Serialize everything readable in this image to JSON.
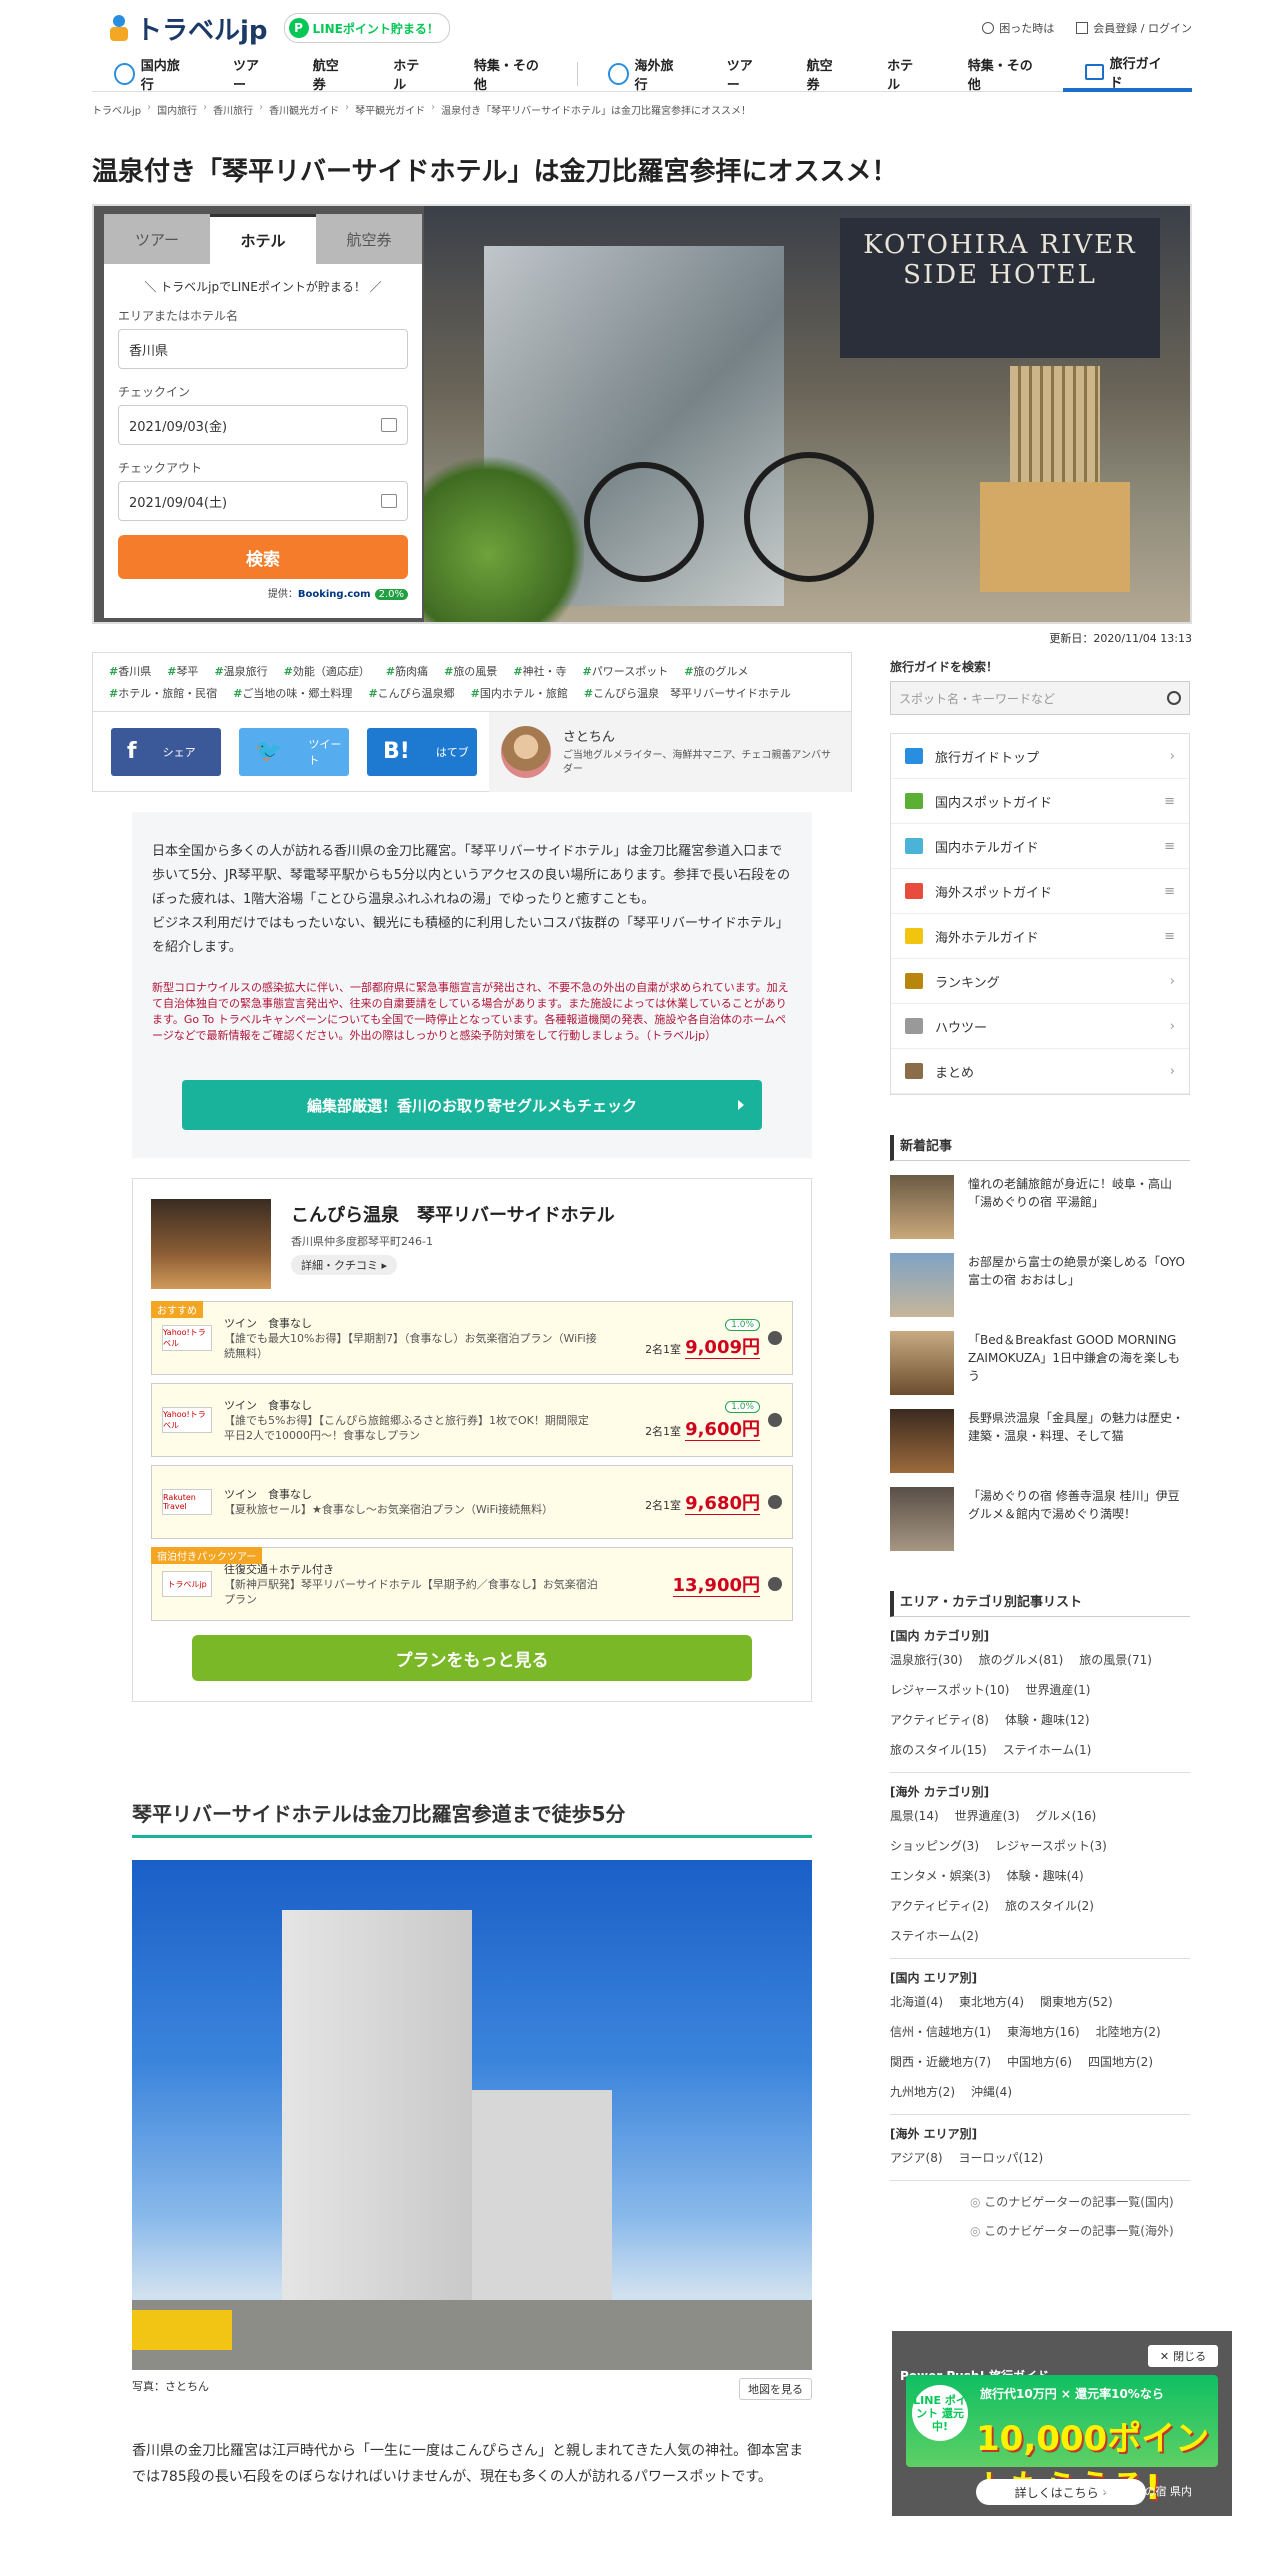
{
  "header": {
    "logo": "トラベルjp",
    "line_pill": "LINEポイント貯まる！",
    "help": "困った時は",
    "login": "会員登録 / ログイン",
    "nav": [
      "国内旅行",
      "ツアー",
      "航空券",
      "ホテル",
      "特集・その他",
      "海外旅行",
      "ツアー",
      "航空券",
      "ホテル",
      "特集・その他"
    ],
    "guide": "旅行ガイド"
  },
  "breadcrumb": [
    "トラベルjp",
    "国内旅行",
    "香川旅行",
    "香川観光ガイド",
    "琴平観光ガイド",
    "温泉付き「琴平リバーサイドホテル」は金刀比羅宮参拝にオススメ！"
  ],
  "title": "温泉付き「琴平リバーサイドホテル」は金刀比羅宮参拝にオススメ！",
  "hero": {
    "sign": "KOTOHIRA RIVER SIDE HOTEL"
  },
  "search": {
    "tabs": [
      "ツアー",
      "ホテル",
      "航空券"
    ],
    "promo": "＼ トラベルjpでLINEポイントが貯まる！ ／",
    "area_label": "エリアまたはホテル名",
    "area_value": "香川県",
    "checkin_label": "チェックイン",
    "checkin_value": "2021/09/03(金)",
    "checkout_label": "チェックアウト",
    "checkout_value": "2021/09/04(土)",
    "button": "検索",
    "provider_prefix": "提供：",
    "provider": "Booking.com",
    "provider_pct": "2.0%"
  },
  "updated": "更新日：2020/11/04 13:13",
  "tags": [
    "香川県",
    "琴平",
    "温泉旅行",
    "効能（適応症）",
    "筋肉痛",
    "旅の風景",
    "神社・寺",
    "パワースポット",
    "旅のグルメ",
    "ホテル・旅館・民宿",
    "ご当地の味・郷土料理",
    "こんぴら温泉郷",
    "国内ホテル・旅館",
    "こんぴら温泉　琴平リバーサイドホテル"
  ],
  "share": {
    "fb": "シェア",
    "tw": "ツイート",
    "hb": "はてブ",
    "fb_icon": "f",
    "hb_icon": "B!"
  },
  "author": {
    "name": "さとちん",
    "desc": "ご当地グルメライター、海鮮丼マニア、チェコ親善アンバサダー"
  },
  "lead": {
    "p1": "日本全国から多くの人が訪れる香川県の金刀比羅宮。「琴平リバーサイドホテル」は金刀比羅宮参道入口まで歩いて5分、JR琴平駅、琴電琴平駅からも5分以内というアクセスの良い場所にあります。参拝で長い石段をのぼった疲れは、1階大浴場「ことひら温泉ふれふれねの湯」でゆったりと癒すことも。",
    "p2": "ビジネス利用だけではもったいない、観光にも積極的に利用したいコスパ抜群の「琴平リバーサイドホテル」を紹介します。",
    "warn": "新型コロナウイルスの感染拡大に伴い、一部都府県に緊急事態宣言が発出され、不要不急の外出の自粛が求められています。加えて自治体独自での緊急事態宣言発出や、往来の自粛要請をしている場合があります。また施設によっては休業していることがあります。Go To トラベルキャンペーンについても全国で一時停止となっています。各種報道機関の発表、施設や各自治体のホームページなどで最新情報をご確認ください。外出の際はしっかりと感染予防対策をして行動しましょう。（トラベルjp）",
    "button": "編集部厳選！香川のお取り寄せグルメもチェック"
  },
  "hotel": {
    "name": "こんぴら温泉　琴平リバーサイドホテル",
    "address": "香川県仲多度郡琴平町246-1",
    "review": "詳細・クチコミ ▸",
    "plans": [
      {
        "badge": "おすすめ",
        "logo": "Yahoo!トラベル",
        "room": "ツイン　食事なし",
        "desc": "【誰でも最大10%お得】【早期割7】（食事なし）お気楽宿泊プラン（WiFi接続無料）",
        "points": "1.0%",
        "per": "2名1室",
        "price": "9,009円"
      },
      {
        "badge": "",
        "logo": "Yahoo!トラベル",
        "room": "ツイン　食事なし",
        "desc": "【誰でも5%お得】【こんぴら旅館郷ふるさと旅行券】1枚でOK！期間限定　平日2人で10000円～！食事なしプラン",
        "points": "1.0%",
        "per": "2名1室",
        "price": "9,600円"
      },
      {
        "badge": "",
        "logo": "Rakuten Travel",
        "room": "ツイン　食事なし",
        "desc": "【夏秋旅セール】★食事なし〜お気楽宿泊プラン（WiFi接続無料）",
        "points": "",
        "per": "2名1室",
        "price": "9,680円"
      },
      {
        "badge": "宿泊付きパックツアー",
        "logo": "トラベルjp",
        "room": "往復交通＋ホテル付き",
        "desc": "【新神戸駅発】琴平リバーサイドホテル【早期予約／食事なし】お気楽宿泊プラン",
        "points": "",
        "per": "",
        "price": "13,900円"
      }
    ],
    "more": "プランをもっと見る"
  },
  "section": {
    "title": "琴平リバーサイドホテルは金刀比羅宮参道まで徒歩5分",
    "caption": "写真：さとちん",
    "map": "地図を見る",
    "text": "香川県の金刀比羅宮は江戸時代から「一生に一度はこんぴらさん」と親しまれてきた人気の神社。御本宮までは785段の長い石段をのぼらなければいけませんが、現在も多くの人が訪れるパワースポットです。"
  },
  "sidebar": {
    "search_title": "旅行ガイドを検索！",
    "search_placeholder": "スポット名・キーワードなど",
    "menu": [
      "旅行ガイドトップ",
      "国内スポットガイド",
      "国内ホテルガイド",
      "海外スポットガイド",
      "海外ホテルガイド",
      "ランキング",
      "ハウツー",
      "まとめ"
    ],
    "news_title": "新着記事",
    "news": [
      "憧れの老舗旅館が身近に！岐阜・高山「湯めぐりの宿 平湯館」",
      "お部屋から富士の絶景が楽しめる「OYO 富士の宿 おおはし」",
      "「Bed＆Breakfast GOOD MORNING ZAIMOKUZA」1日中鎌倉の海を楽しもう",
      "長野県渋温泉「金具屋」の魅力は歴史・建築・温泉・料理、そして猫",
      "「湯めぐりの宿 修善寺温泉 桂川」伊豆グルメ＆館内で湯めぐり満喫！"
    ],
    "cat_title": "エリア・カテゴリ別記事リスト",
    "cats": [
      {
        "h": "[国内 カテゴリ別]",
        "links": [
          "温泉旅行(30)",
          "旅のグルメ(81)",
          "旅の風景(71)",
          "レジャースポット(10)",
          "世界遺産(1)",
          "アクティビティ(8)",
          "体験・趣味(12)",
          "旅のスタイル(15)",
          "ステイホーム(1)"
        ]
      },
      {
        "h": "[海外 カテゴリ別]",
        "links": [
          "風景(14)",
          "世界遺産(3)",
          "グルメ(16)",
          "ショッピング(3)",
          "レジャースポット(3)",
          "エンタメ・娯楽(3)",
          "体験・趣味(4)",
          "アクティビティ(2)",
          "旅のスタイル(2)",
          "ステイホーム(2)"
        ]
      },
      {
        "h": "[国内 エリア別]",
        "links": [
          "北海道(4)",
          "東北地方(4)",
          "関東地方(52)",
          "信州・信越地方(1)",
          "東海地方(16)",
          "北陸地方(2)",
          "関西・近畿地方(7)",
          "中国地方(6)",
          "四国地方(2)",
          "九州地方(2)",
          "沖縄(4)"
        ]
      },
      {
        "h": "[海外 エリア別]",
        "links": [
          "アジア(8)",
          "ヨーロッパ(12)"
        ]
      }
    ],
    "nav_links": [
      "このナビゲーターの記事一覧(国内)",
      "このナビゲーターの記事一覧(海外)"
    ]
  },
  "popup": {
    "close": "閉じる",
    "badge": "LINE ポイント 還元中!",
    "top": "旅行代10万円 × 還元率10%なら",
    "big": "10,000ポイントもらえる!",
    "detail": "詳しくはこちら",
    "bg_title": "Power Push! 旅行ガイド",
    "bg_text": "湯めぐりの宿 県内"
  }
}
